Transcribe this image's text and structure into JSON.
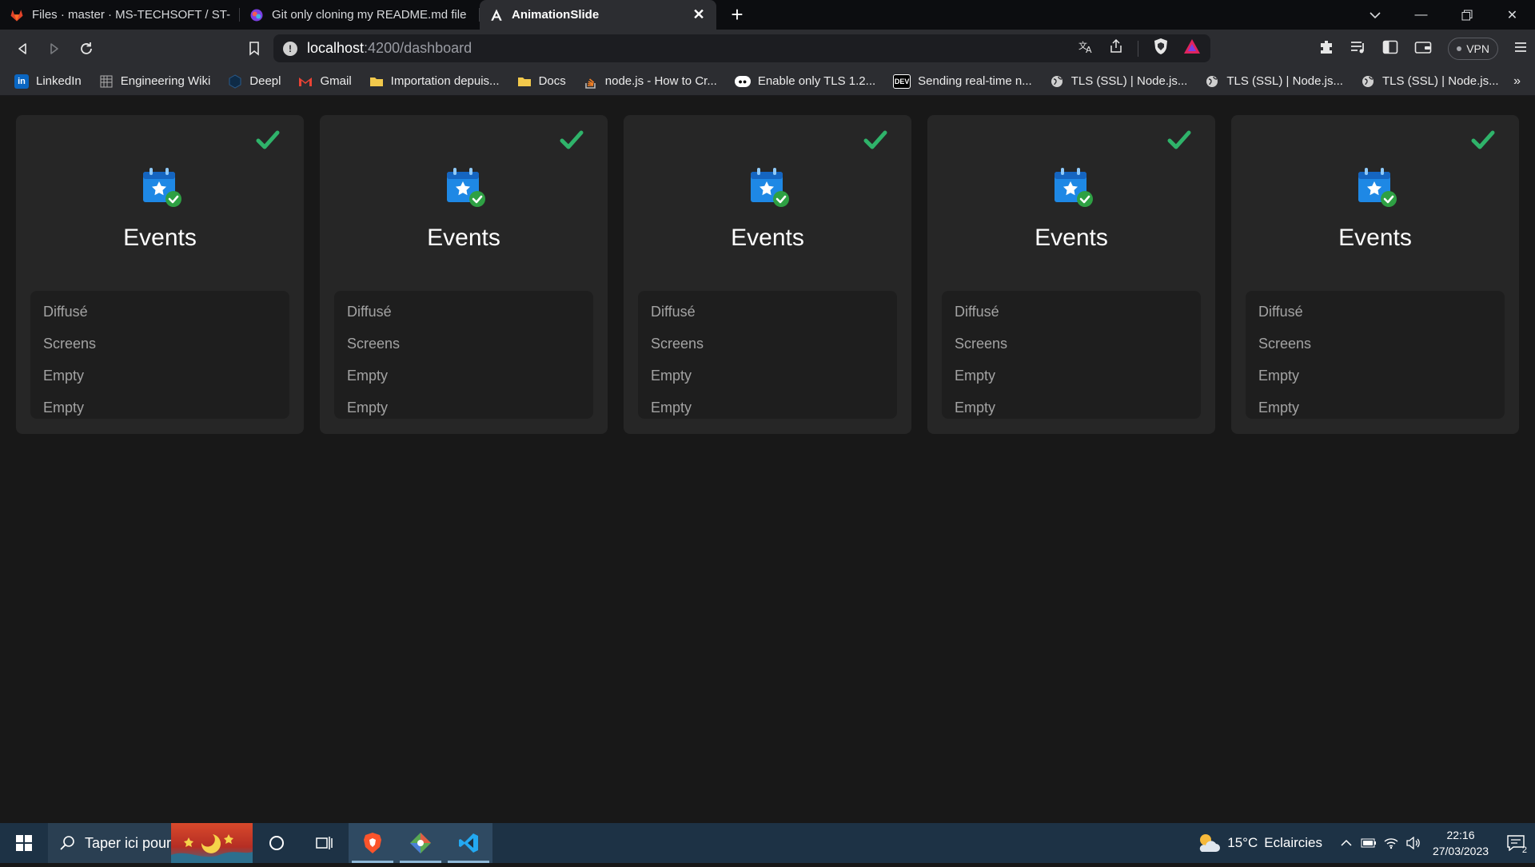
{
  "browser": {
    "tabs": [
      {
        "title": "Files · master · MS-TECHSOFT / ST-DYN",
        "icon": "gitlab-icon",
        "active": false
      },
      {
        "title": "Git only cloning my README.md file a",
        "icon": "colorful-app-icon",
        "active": false
      },
      {
        "title": "AnimationSlide",
        "icon": "angular-icon",
        "active": true
      }
    ],
    "new_tab_label": "+",
    "url": {
      "host": "localhost",
      "path": ":4200/dashboard"
    },
    "vpn_label": "VPN"
  },
  "bookmarks": [
    {
      "label": "LinkedIn",
      "icon": "linkedin-icon",
      "color": "#0a66c2"
    },
    {
      "label": "Engineering Wiki",
      "icon": "wiki-icon",
      "color": "#9a9a9a"
    },
    {
      "label": "Deepl",
      "icon": "deepl-icon",
      "color": "#0f2b46"
    },
    {
      "label": "Gmail",
      "icon": "gmail-icon",
      "color": "#ea4335"
    },
    {
      "label": "Importation depuis...",
      "icon": "folder-icon",
      "color": "#f2c94c"
    },
    {
      "label": "Docs",
      "icon": "folder-icon",
      "color": "#f2c94c"
    },
    {
      "label": "node.js - How to Cr...",
      "icon": "stackoverflow-icon",
      "color": "#f48024"
    },
    {
      "label": "Enable only TLS 1.2...",
      "icon": "medium-icon",
      "color": "#ffffff"
    },
    {
      "label": "Sending real-time n...",
      "icon": "dev-icon",
      "color": "#ffffff"
    },
    {
      "label": "TLS (SSL) | Node.js...",
      "icon": "globe-icon",
      "color": "#cfcfcf"
    },
    {
      "label": "TLS (SSL) | Node.js...",
      "icon": "globe-icon",
      "color": "#cfcfcf"
    },
    {
      "label": "TLS (SSL) | Node.js...",
      "icon": "globe-icon",
      "color": "#cfcfcf"
    }
  ],
  "bookmarks_more_label": "»",
  "main": {
    "cards": [
      {
        "title": "Events",
        "items": [
          "Diffusé",
          "Screens",
          "Empty",
          "Empty"
        ]
      },
      {
        "title": "Events",
        "items": [
          "Diffusé",
          "Screens",
          "Empty",
          "Empty"
        ]
      },
      {
        "title": "Events",
        "items": [
          "Diffusé",
          "Screens",
          "Empty",
          "Empty"
        ]
      },
      {
        "title": "Events",
        "items": [
          "Diffusé",
          "Screens",
          "Empty",
          "Empty"
        ]
      },
      {
        "title": "Events",
        "items": [
          "Diffusé",
          "Screens",
          "Empty",
          "Empty"
        ]
      }
    ],
    "colors": {
      "check": "#2fb36a",
      "calendar": "#1e88e5",
      "card": "#262626",
      "list": "#1e1e1e"
    }
  },
  "taskbar": {
    "search_placeholder": "Taper ici pour",
    "weather": {
      "temp": "15°C",
      "condition": "Eclaircies"
    },
    "clock": {
      "time": "22:16",
      "date": "27/03/2023"
    },
    "notification_count": "2"
  }
}
